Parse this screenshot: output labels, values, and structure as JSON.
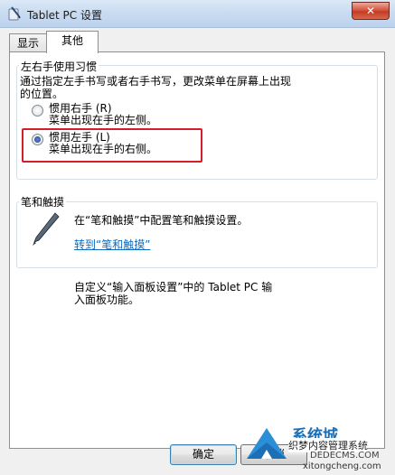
{
  "window": {
    "title": "Tablet PC 设置",
    "close_glyph": "✕"
  },
  "tabs": [
    {
      "label": "显示",
      "active": false
    },
    {
      "label": "其他",
      "active": true
    }
  ],
  "handedness": {
    "group_title": "左右手使用习惯",
    "description_line1": "通过指定左手书写或者右手书写，更改菜单在屏幕上出现",
    "description_line2": "的位置。",
    "options": [
      {
        "label": "惯用右手 (R)",
        "hint": "菜单出现在手的左侧。",
        "checked": false
      },
      {
        "label": "惯用左手 (L)",
        "hint": "菜单出现在手的右侧。",
        "checked": true
      }
    ]
  },
  "pen_touch": {
    "group_title": "笔和触摸",
    "text": "在“笔和触摸”中配置笔和触摸设置。",
    "link": "转到“笔和触摸”"
  },
  "input_panel": {
    "text_line1": "自定义“输入面板设置”中的 Tablet PC 输",
    "text_line2": "入面板功能。"
  },
  "buttons": {
    "ok": "确定",
    "cancel": "取消"
  },
  "watermark": {
    "brand": "系统城",
    "line1": "织梦内容管理系统",
    "line2": "DEDECMS.COM",
    "url": "xitongcheng.com"
  },
  "colors": {
    "highlight_border": "#d21f2a",
    "link": "#0a6ac2",
    "title_bar": "#c8dbf1"
  }
}
